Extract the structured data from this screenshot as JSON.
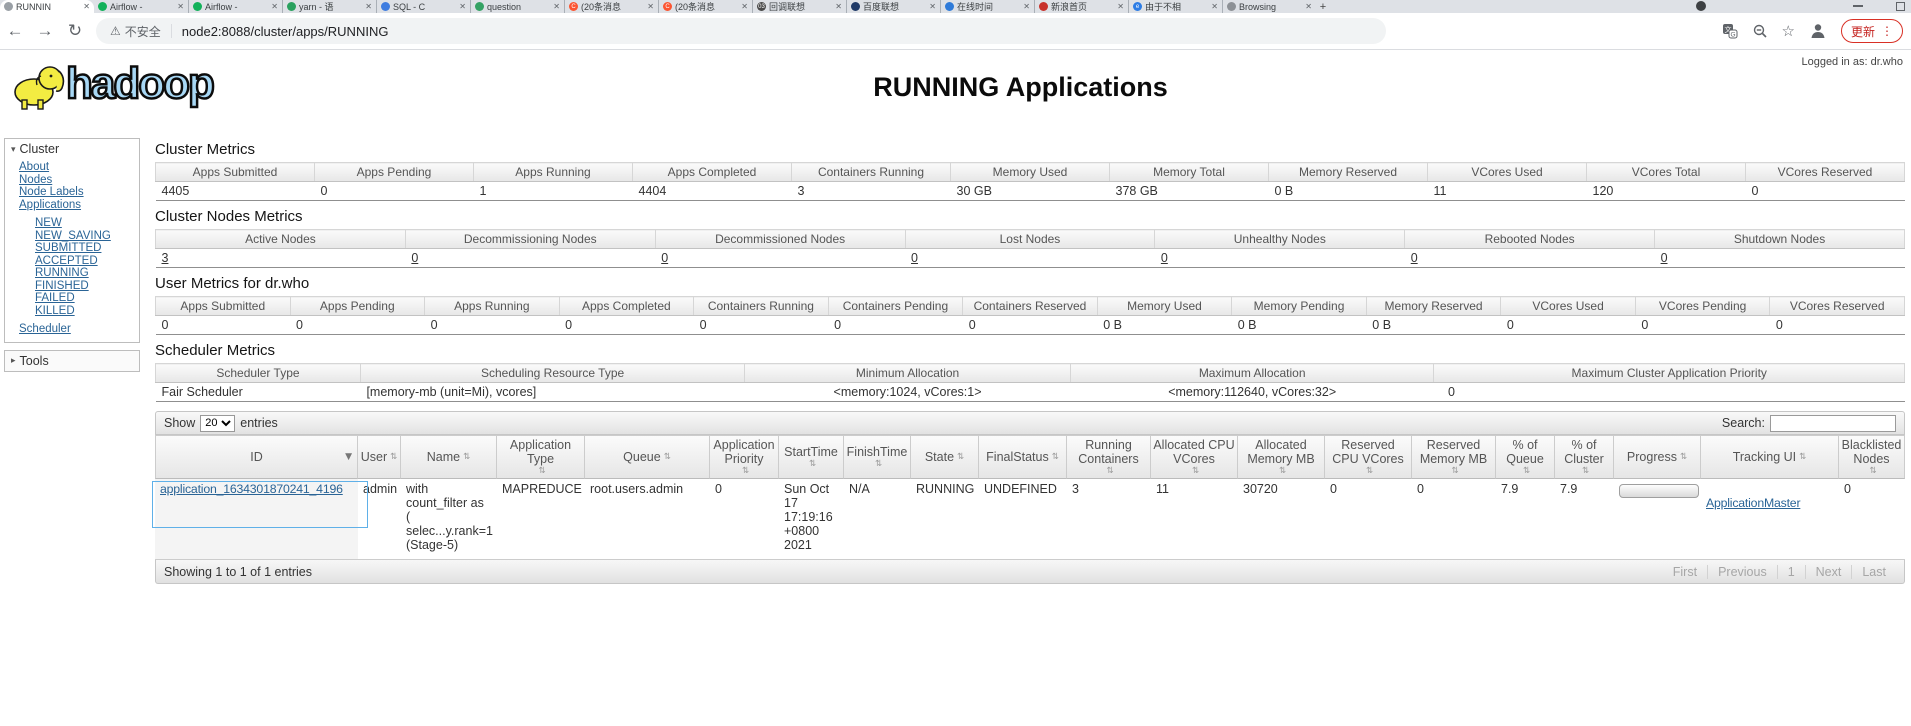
{
  "browser": {
    "tabs": [
      {
        "label": "RUNNIN",
        "glyph": "",
        "color": "#9aa0a6",
        "active": true
      },
      {
        "label": "Airflow -",
        "glyph": "",
        "color": "#12b15a"
      },
      {
        "label": "Airflow -",
        "glyph": "",
        "color": "#12b15a"
      },
      {
        "label": "yarn - 语",
        "glyph": "",
        "color": "#2aa15f"
      },
      {
        "label": "SQL - C",
        "glyph": "",
        "color": "#3f7de0"
      },
      {
        "label": "question",
        "glyph": "",
        "color": "#35a264"
      },
      {
        "label": "(20条消息",
        "glyph": "C",
        "color": "#fc5531"
      },
      {
        "label": "(20条消息",
        "glyph": "C",
        "color": "#fc5531"
      },
      {
        "label": "回调联想",
        "glyph": "03",
        "color": "#4a4a4a"
      },
      {
        "label": "百度联想",
        "glyph": "",
        "color": "#1f3a67"
      },
      {
        "label": "在线时间",
        "glyph": "",
        "color": "#2f7bd9"
      },
      {
        "label": "新浪首页",
        "glyph": "",
        "color": "#c8312b"
      },
      {
        "label": "由于不相",
        "glyph": "e",
        "color": "#2c7ce5"
      },
      {
        "label": "Browsing",
        "glyph": "",
        "color": "#8d9196"
      }
    ],
    "new_tab": "+",
    "security_label": "不安全",
    "url": "node2:8088/cluster/apps/RUNNING",
    "update_label": "更新"
  },
  "header": {
    "logo_word": "hadoop",
    "title": "RUNNING Applications",
    "logged_in": "Logged in as: dr.who"
  },
  "sidebar": {
    "cluster_label": "Cluster",
    "links": [
      "About",
      "Nodes",
      "Node Labels",
      "Applications"
    ],
    "states": [
      "NEW",
      "NEW_SAVING",
      "SUBMITTED",
      "ACCEPTED",
      "RUNNING",
      "FINISHED",
      "FAILED",
      "KILLED"
    ],
    "scheduler_label": "Scheduler",
    "tools_label": "Tools"
  },
  "metrics": {
    "cluster": {
      "title": "Cluster Metrics",
      "headers": [
        "Apps Submitted",
        "Apps Pending",
        "Apps Running",
        "Apps Completed",
        "Containers Running",
        "Memory Used",
        "Memory Total",
        "Memory Reserved",
        "VCores Used",
        "VCores Total",
        "VCores Reserved"
      ],
      "values": [
        "4405",
        "0",
        "1",
        "4404",
        "3",
        "30 GB",
        "378 GB",
        "0 B",
        "11",
        "120",
        "0"
      ]
    },
    "nodes": {
      "title": "Cluster Nodes Metrics",
      "headers": [
        "Active Nodes",
        "Decommissioning Nodes",
        "Decommissioned Nodes",
        "Lost Nodes",
        "Unhealthy Nodes",
        "Rebooted Nodes",
        "Shutdown Nodes"
      ],
      "values": [
        "3",
        "0",
        "0",
        "0",
        "0",
        "0",
        "0"
      ]
    },
    "user": {
      "title": "User Metrics for dr.who",
      "headers": [
        "Apps Submitted",
        "Apps Pending",
        "Apps Running",
        "Apps Completed",
        "Containers Running",
        "Containers Pending",
        "Containers Reserved",
        "Memory Used",
        "Memory Pending",
        "Memory Reserved",
        "VCores Used",
        "VCores Pending",
        "VCores Reserved"
      ],
      "values": [
        "0",
        "0",
        "0",
        "0",
        "0",
        "0",
        "0",
        "0 B",
        "0 B",
        "0 B",
        "0",
        "0",
        "0"
      ]
    },
    "scheduler": {
      "title": "Scheduler Metrics",
      "headers": [
        "Scheduler Type",
        "Scheduling Resource Type",
        "Minimum Allocation",
        "Maximum Allocation",
        "Maximum Cluster Application Priority"
      ],
      "values": [
        "Fair Scheduler",
        "[memory-mb (unit=Mi), vcores]",
        "<memory:1024, vCores:1>",
        "<memory:112640, vCores:32>",
        "0"
      ]
    }
  },
  "apps_table": {
    "toolbar": {
      "show": "Show",
      "page_size": "20",
      "entries": "entries",
      "search": "Search:"
    },
    "columns": [
      {
        "label": "ID",
        "sort": "▼"
      },
      {
        "label": "User",
        "sort": "⇅"
      },
      {
        "label": "Name",
        "sort": "⇅"
      },
      {
        "label": "Application Type",
        "sort": "⇅"
      },
      {
        "label": "Queue",
        "sort": "⇅"
      },
      {
        "label": "Application Priority",
        "sort": "⇅"
      },
      {
        "label": "StartTime",
        "sort": "⇅"
      },
      {
        "label": "FinishTime",
        "sort": "⇅"
      },
      {
        "label": "State",
        "sort": "⇅"
      },
      {
        "label": "FinalStatus",
        "sort": "⇅"
      },
      {
        "label": "Running Containers",
        "sort": "⇅"
      },
      {
        "label": "Allocated CPU VCores",
        "sort": "⇅"
      },
      {
        "label": "Allocated Memory MB",
        "sort": "⇅"
      },
      {
        "label": "Reserved CPU VCores",
        "sort": "⇅"
      },
      {
        "label": "Reserved Memory MB",
        "sort": "⇅"
      },
      {
        "label": "% of Queue",
        "sort": "⇅"
      },
      {
        "label": "% of Cluster",
        "sort": "⇅"
      },
      {
        "label": "Progress",
        "sort": "⇅"
      },
      {
        "label": "Tracking UI",
        "sort": "⇅"
      },
      {
        "label": "Blacklisted Nodes",
        "sort": "⇅"
      }
    ],
    "row": {
      "id": "application_1634301870241_4196",
      "user": "admin",
      "name": "with\ncount_filter as\n(\nselec...y.rank=1\n(Stage-5)",
      "app_type": "MAPREDUCE",
      "queue": "root.users.admin",
      "priority": "0",
      "start_time": "Sun Oct\n17\n17:19:16\n+0800\n2021",
      "finish_time": "N/A",
      "state": "RUNNING",
      "final_status": "UNDEFINED",
      "running_containers": "3",
      "allocated_cpu": "11",
      "allocated_memory": "30720",
      "reserved_cpu": "0",
      "reserved_memory": "0",
      "pct_queue": "7.9",
      "pct_cluster": "7.9",
      "tracking_ui": "ApplicationMaster",
      "blacklisted": "0"
    },
    "footer": {
      "info": "Showing 1 to 1 of 1 entries",
      "pages": [
        "First",
        "Previous",
        "1",
        "Next",
        "Last"
      ]
    }
  }
}
